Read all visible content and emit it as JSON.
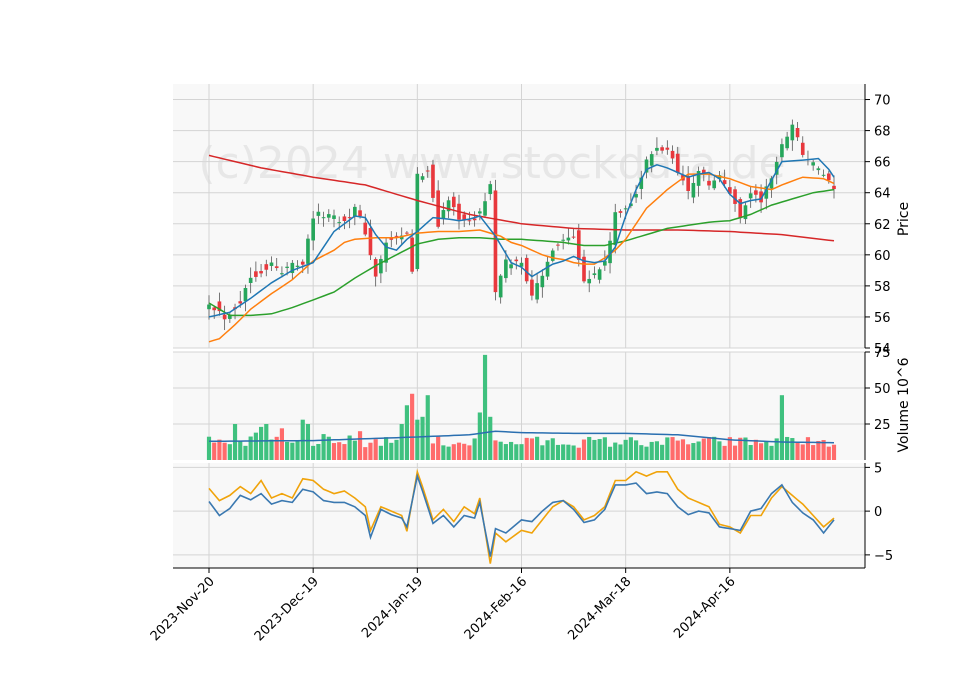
{
  "watermark": "(c)2024 www.stockdata.de",
  "chart_data": [
    {
      "type": "candlestick",
      "panel": "price",
      "ylabel": "Price",
      "ylim": [
        54,
        71
      ],
      "yticks": [
        54,
        56,
        58,
        60,
        62,
        64,
        66,
        68,
        70
      ],
      "x_ticks": [
        "2023-Nov-20",
        "2023-Dec-19",
        "2024-Jan-19",
        "2024-Feb-16",
        "2024-Mar-18",
        "2024-Apr-16"
      ],
      "x_tick_index": [
        0,
        20,
        40,
        60,
        80,
        100
      ],
      "grid": true,
      "series_colors": {
        "up": "#26a65b",
        "down": "#e8383d",
        "ma_short": "#1f77b4",
        "ma_mid": "#ff7f0e",
        "ma_long": "#2ca02c",
        "ma_trend": "#d62728"
      },
      "close_anchors": [
        [
          0,
          57.0
        ],
        [
          3,
          56.0
        ],
        [
          6,
          57.0
        ],
        [
          8,
          58.6
        ],
        [
          10,
          59.0
        ],
        [
          12,
          59.4
        ],
        [
          14,
          58.8
        ],
        [
          16,
          59.5
        ],
        [
          18,
          59.5
        ],
        [
          20,
          62.5
        ],
        [
          23,
          62.6
        ],
        [
          26,
          62.2
        ],
        [
          28,
          63.0
        ],
        [
          30,
          61.5
        ],
        [
          32,
          58.5
        ],
        [
          34,
          60.8
        ],
        [
          36,
          61.0
        ],
        [
          38,
          61.3
        ],
        [
          39,
          59.0
        ],
        [
          40,
          65.0
        ],
        [
          42,
          65.5
        ],
        [
          44,
          62.0
        ],
        [
          46,
          63.5
        ],
        [
          48,
          62.5
        ],
        [
          50,
          62.0
        ],
        [
          52,
          62.7
        ],
        [
          54,
          64.5
        ],
        [
          55,
          57.5
        ],
        [
          57,
          59.5
        ],
        [
          60,
          59.5
        ],
        [
          62,
          57.5
        ],
        [
          64,
          58.5
        ],
        [
          66,
          60.5
        ],
        [
          68,
          61.0
        ],
        [
          70,
          61.3
        ],
        [
          72,
          58.5
        ],
        [
          74,
          58.7
        ],
        [
          76,
          59.5
        ],
        [
          78,
          62.5
        ],
        [
          80,
          63.0
        ],
        [
          82,
          64.0
        ],
        [
          84,
          66.0
        ],
        [
          86,
          66.8
        ],
        [
          88,
          66.8
        ],
        [
          90,
          65.5
        ],
        [
          92,
          64.0
        ],
        [
          94,
          65.5
        ],
        [
          96,
          64.5
        ],
        [
          98,
          65.0
        ],
        [
          100,
          64.0
        ],
        [
          102,
          62.5
        ],
        [
          104,
          64.0
        ],
        [
          106,
          63.5
        ],
        [
          108,
          65.0
        ],
        [
          110,
          67.0
        ],
        [
          112,
          68.5
        ],
        [
          114,
          66.5
        ],
        [
          116,
          65.8
        ],
        [
          118,
          65.2
        ],
        [
          120,
          64.0
        ]
      ],
      "ma_short_anchors": [
        [
          0,
          56.0
        ],
        [
          4,
          56.3
        ],
        [
          8,
          57.2
        ],
        [
          12,
          58.2
        ],
        [
          16,
          59.0
        ],
        [
          20,
          59.5
        ],
        [
          24,
          61.5
        ],
        [
          28,
          62.5
        ],
        [
          30,
          62.4
        ],
        [
          32,
          61.3
        ],
        [
          34,
          60.5
        ],
        [
          36,
          60.3
        ],
        [
          38,
          61.0
        ],
        [
          40,
          61.5
        ],
        [
          43,
          62.4
        ],
        [
          46,
          62.3
        ],
        [
          48,
          62.2
        ],
        [
          50,
          62.3
        ],
        [
          52,
          62.5
        ],
        [
          55,
          61.2
        ],
        [
          58,
          59.5
        ],
        [
          60,
          59.2
        ],
        [
          62,
          58.6
        ],
        [
          64,
          59.0
        ],
        [
          66,
          59.4
        ],
        [
          68,
          59.6
        ],
        [
          70,
          59.9
        ],
        [
          72,
          59.6
        ],
        [
          74,
          59.5
        ],
        [
          76,
          59.6
        ],
        [
          78,
          60.5
        ],
        [
          80,
          62.5
        ],
        [
          82,
          64.2
        ],
        [
          84,
          65.5
        ],
        [
          86,
          65.8
        ],
        [
          88,
          65.6
        ],
        [
          90,
          65.3
        ],
        [
          92,
          65.0
        ],
        [
          94,
          65.2
        ],
        [
          96,
          65.3
        ],
        [
          98,
          64.9
        ],
        [
          100,
          63.9
        ],
        [
          102,
          63.3
        ],
        [
          104,
          63.5
        ],
        [
          106,
          63.6
        ],
        [
          108,
          64.8
        ],
        [
          110,
          66.0
        ],
        [
          114,
          66.1
        ],
        [
          117,
          66.2
        ],
        [
          119,
          65.5
        ],
        [
          120,
          65.0
        ]
      ],
      "ma_mid_anchors": [
        [
          0,
          54.4
        ],
        [
          2,
          54.6
        ],
        [
          5,
          55.5
        ],
        [
          8,
          56.5
        ],
        [
          12,
          57.5
        ],
        [
          16,
          58.4
        ],
        [
          20,
          59.6
        ],
        [
          24,
          60.3
        ],
        [
          26,
          60.8
        ],
        [
          28,
          61.0
        ],
        [
          32,
          61.1
        ],
        [
          36,
          61.1
        ],
        [
          40,
          61.4
        ],
        [
          44,
          61.5
        ],
        [
          48,
          61.5
        ],
        [
          52,
          61.6
        ],
        [
          56,
          61.2
        ],
        [
          58,
          60.8
        ],
        [
          60,
          60.6
        ],
        [
          62,
          60.3
        ],
        [
          64,
          60.0
        ],
        [
          66,
          59.8
        ],
        [
          68,
          59.7
        ],
        [
          70,
          59.5
        ],
        [
          72,
          59.4
        ],
        [
          74,
          59.4
        ],
        [
          76,
          59.8
        ],
        [
          78,
          60.3
        ],
        [
          80,
          61.0
        ],
        [
          82,
          62.0
        ],
        [
          84,
          63.0
        ],
        [
          88,
          64.2
        ],
        [
          92,
          65.2
        ],
        [
          96,
          65.2
        ],
        [
          100,
          64.9
        ],
        [
          104,
          64.4
        ],
        [
          108,
          64.2
        ],
        [
          110,
          64.5
        ],
        [
          114,
          65.0
        ],
        [
          118,
          64.9
        ],
        [
          120,
          64.6
        ]
      ],
      "ma_long_anchors": [
        [
          0,
          56.9
        ],
        [
          4,
          56.1
        ],
        [
          8,
          56.1
        ],
        [
          12,
          56.2
        ],
        [
          16,
          56.6
        ],
        [
          20,
          57.1
        ],
        [
          24,
          57.6
        ],
        [
          28,
          58.5
        ],
        [
          32,
          59.3
        ],
        [
          36,
          60.0
        ],
        [
          40,
          60.7
        ],
        [
          44,
          61.0
        ],
        [
          48,
          61.1
        ],
        [
          52,
          61.1
        ],
        [
          56,
          61.0
        ],
        [
          60,
          61.0
        ],
        [
          64,
          60.9
        ],
        [
          68,
          60.8
        ],
        [
          72,
          60.6
        ],
        [
          76,
          60.6
        ],
        [
          80,
          60.9
        ],
        [
          84,
          61.3
        ],
        [
          88,
          61.7
        ],
        [
          92,
          61.9
        ],
        [
          96,
          62.1
        ],
        [
          100,
          62.2
        ],
        [
          104,
          62.6
        ],
        [
          108,
          63.2
        ],
        [
          112,
          63.6
        ],
        [
          116,
          64.0
        ],
        [
          120,
          64.2
        ]
      ],
      "ma_trend_anchors": [
        [
          0,
          66.4
        ],
        [
          10,
          65.6
        ],
        [
          20,
          65.0
        ],
        [
          30,
          64.5
        ],
        [
          40,
          63.5
        ],
        [
          50,
          62.6
        ],
        [
          60,
          62.0
        ],
        [
          70,
          61.7
        ],
        [
          80,
          61.6
        ],
        [
          90,
          61.6
        ],
        [
          100,
          61.5
        ],
        [
          110,
          61.3
        ],
        [
          120,
          60.9
        ]
      ]
    },
    {
      "type": "bar",
      "panel": "volume",
      "ylabel": "Volume  10^6",
      "ylim": [
        0,
        75
      ],
      "yticks": [
        25,
        50,
        75
      ],
      "count": 121,
      "volume_avg_level": 12.5,
      "spikes": [
        [
          3,
          12
        ],
        [
          4,
          11
        ],
        [
          5,
          25
        ],
        [
          9,
          19
        ],
        [
          10,
          23
        ],
        [
          11,
          25
        ],
        [
          14,
          22
        ],
        [
          16,
          12
        ],
        [
          18,
          28
        ],
        [
          19,
          25
        ],
        [
          22,
          18
        ],
        [
          27,
          17
        ],
        [
          29,
          20
        ],
        [
          31,
          12
        ],
        [
          36,
          14
        ],
        [
          37,
          25
        ],
        [
          38,
          38
        ],
        [
          39,
          46
        ],
        [
          40,
          28
        ],
        [
          41,
          30
        ],
        [
          42,
          45
        ],
        [
          52,
          33
        ],
        [
          53,
          73
        ],
        [
          54,
          30
        ],
        [
          60,
          11
        ],
        [
          62,
          15
        ],
        [
          80,
          14
        ],
        [
          86,
          13
        ],
        [
          109,
          15
        ],
        [
          110,
          45
        ],
        [
          111,
          16
        ],
        [
          113,
          12
        ]
      ],
      "ma_anchors": [
        [
          0,
          13
        ],
        [
          20,
          13.5
        ],
        [
          40,
          16
        ],
        [
          50,
          17.5
        ],
        [
          55,
          20
        ],
        [
          60,
          19
        ],
        [
          70,
          18.5
        ],
        [
          80,
          18.5
        ],
        [
          90,
          17.5
        ],
        [
          100,
          14
        ],
        [
          110,
          12.5
        ],
        [
          120,
          12
        ]
      ]
    },
    {
      "type": "line",
      "panel": "oscillator",
      "ylim": [
        -6.5,
        5.5
      ],
      "yticks": [
        -5,
        0,
        5
      ],
      "series_colors": [
        "#f0a30a",
        "#3a78b0"
      ],
      "series_a_anchors": [
        [
          0,
          2.6
        ],
        [
          2,
          1.2
        ],
        [
          4,
          1.8
        ],
        [
          6,
          2.8
        ],
        [
          8,
          2.0
        ],
        [
          10,
          3.5
        ],
        [
          12,
          1.5
        ],
        [
          14,
          2.0
        ],
        [
          16,
          1.5
        ],
        [
          18,
          3.7
        ],
        [
          20,
          3.5
        ],
        [
          22,
          2.5
        ],
        [
          24,
          2.0
        ],
        [
          26,
          2.3
        ],
        [
          28,
          1.5
        ],
        [
          30,
          0.5
        ],
        [
          31,
          -2.2
        ],
        [
          33,
          0.5
        ],
        [
          35,
          0.0
        ],
        [
          37,
          -0.5
        ],
        [
          38,
          -2.3
        ],
        [
          40,
          4.5
        ],
        [
          41,
          2.8
        ],
        [
          43,
          -1.0
        ],
        [
          45,
          0.2
        ],
        [
          47,
          -1.2
        ],
        [
          49,
          0.5
        ],
        [
          51,
          -0.3
        ],
        [
          52,
          1.5
        ],
        [
          54,
          -6.0
        ],
        [
          55,
          -2.5
        ],
        [
          57,
          -3.5
        ],
        [
          60,
          -2.2
        ],
        [
          62,
          -2.5
        ],
        [
          64,
          -1.0
        ],
        [
          66,
          0.5
        ],
        [
          68,
          1.2
        ],
        [
          70,
          0.5
        ],
        [
          72,
          -1.0
        ],
        [
          74,
          -0.5
        ],
        [
          76,
          0.5
        ],
        [
          78,
          3.5
        ],
        [
          80,
          3.5
        ],
        [
          82,
          4.5
        ],
        [
          84,
          4.0
        ],
        [
          86,
          4.5
        ],
        [
          88,
          4.5
        ],
        [
          90,
          2.5
        ],
        [
          92,
          1.5
        ],
        [
          94,
          1.0
        ],
        [
          96,
          0.5
        ],
        [
          98,
          -1.5
        ],
        [
          100,
          -1.8
        ],
        [
          102,
          -2.5
        ],
        [
          104,
          -0.5
        ],
        [
          106,
          -0.5
        ],
        [
          108,
          1.5
        ],
        [
          110,
          2.8
        ],
        [
          112,
          1.8
        ],
        [
          114,
          0.8
        ],
        [
          116,
          -0.5
        ],
        [
          118,
          -1.8
        ],
        [
          120,
          -0.8
        ]
      ],
      "series_b_anchors": [
        [
          0,
          1.1
        ],
        [
          2,
          -0.5
        ],
        [
          4,
          0.3
        ],
        [
          6,
          1.8
        ],
        [
          8,
          1.3
        ],
        [
          10,
          2.0
        ],
        [
          12,
          0.8
        ],
        [
          14,
          1.2
        ],
        [
          16,
          1.0
        ],
        [
          18,
          2.5
        ],
        [
          20,
          2.2
        ],
        [
          22,
          1.2
        ],
        [
          24,
          1.0
        ],
        [
          26,
          1.0
        ],
        [
          28,
          0.5
        ],
        [
          30,
          -0.5
        ],
        [
          31,
          -3.0
        ],
        [
          33,
          0.2
        ],
        [
          35,
          -0.4
        ],
        [
          37,
          -0.8
        ],
        [
          38,
          -1.8
        ],
        [
          40,
          4.0
        ],
        [
          41,
          2.3
        ],
        [
          43,
          -1.4
        ],
        [
          45,
          -0.5
        ],
        [
          47,
          -1.8
        ],
        [
          49,
          -0.5
        ],
        [
          51,
          -0.8
        ],
        [
          52,
          1.0
        ],
        [
          54,
          -5.2
        ],
        [
          55,
          -2.0
        ],
        [
          57,
          -2.5
        ],
        [
          60,
          -1.0
        ],
        [
          62,
          -1.2
        ],
        [
          64,
          0.0
        ],
        [
          66,
          1.0
        ],
        [
          68,
          1.2
        ],
        [
          70,
          0.2
        ],
        [
          72,
          -1.3
        ],
        [
          74,
          -1.0
        ],
        [
          76,
          0.2
        ],
        [
          78,
          3.0
        ],
        [
          80,
          3.0
        ],
        [
          82,
          3.2
        ],
        [
          84,
          2.0
        ],
        [
          86,
          2.2
        ],
        [
          88,
          2.0
        ],
        [
          90,
          0.5
        ],
        [
          92,
          -0.4
        ],
        [
          94,
          0.0
        ],
        [
          96,
          -0.2
        ],
        [
          98,
          -1.8
        ],
        [
          100,
          -2.0
        ],
        [
          102,
          -2.2
        ],
        [
          104,
          0.0
        ],
        [
          106,
          0.3
        ],
        [
          108,
          2.0
        ],
        [
          110,
          3.0
        ],
        [
          112,
          1.0
        ],
        [
          114,
          -0.2
        ],
        [
          116,
          -1.0
        ],
        [
          118,
          -2.5
        ],
        [
          120,
          -1.0
        ]
      ]
    }
  ]
}
